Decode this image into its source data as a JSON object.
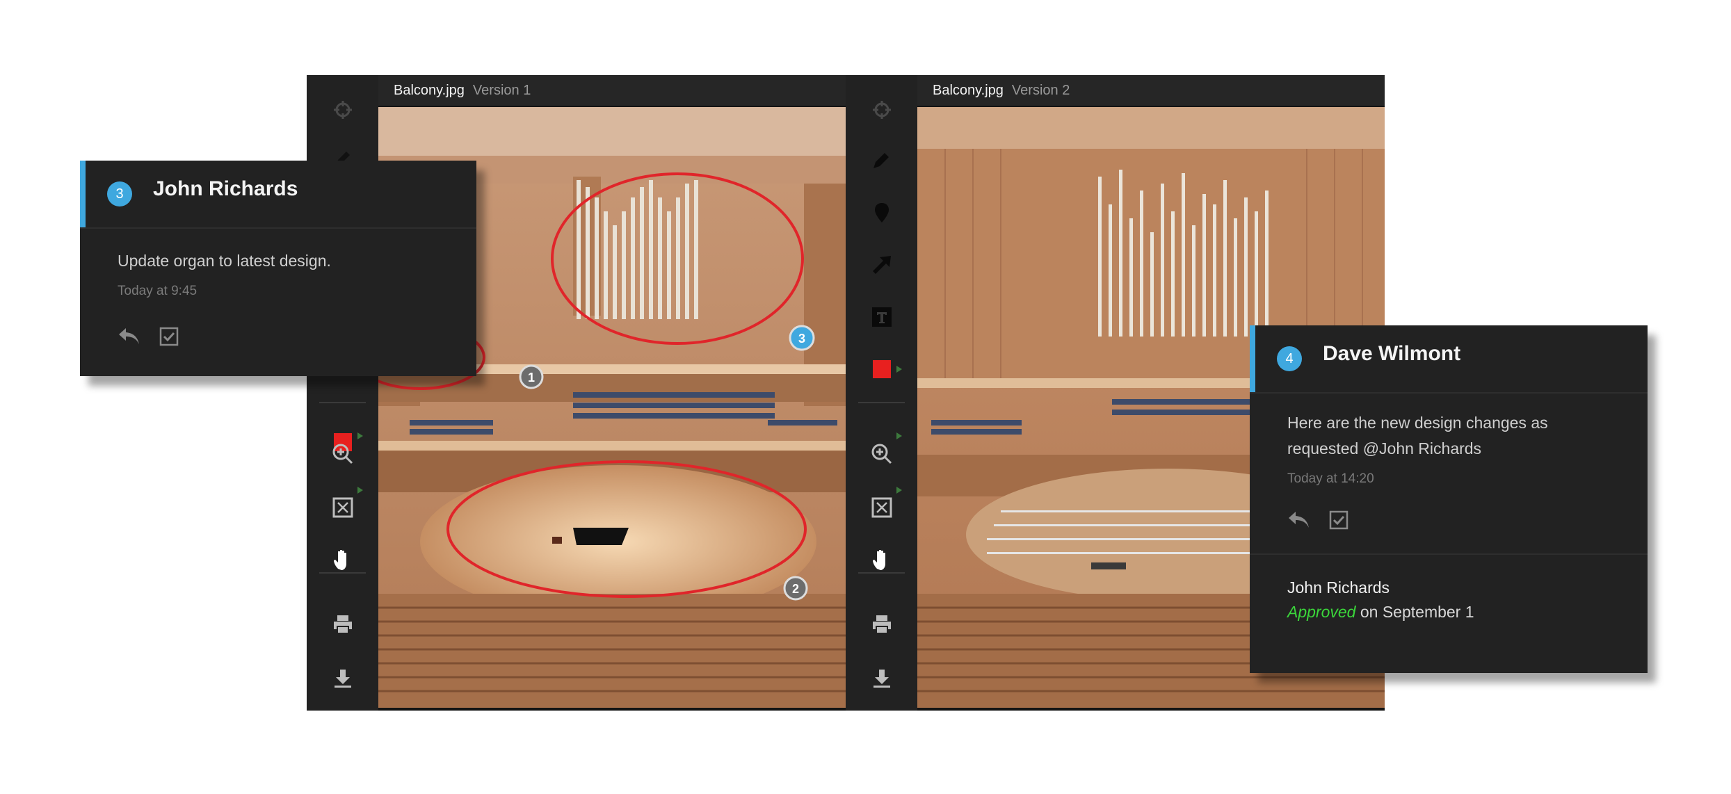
{
  "left_pane": {
    "filename": "Balcony.jpg",
    "version": "Version 1"
  },
  "right_pane": {
    "filename": "Balcony.jpg",
    "version": "Version 2"
  },
  "markers": [
    "1",
    "2",
    "3"
  ],
  "toolbar_tools": [
    "crosshair-icon",
    "pencil-icon",
    "pin-icon",
    "arrow-icon",
    "text-icon",
    "color-swatch",
    "zoom-icon",
    "fit-screen-icon",
    "hand-icon",
    "print-icon",
    "download-icon"
  ],
  "colors": {
    "accent": "#3fa8df",
    "annotation": "#e0252a",
    "approved": "#3bd63b",
    "swatch": "#e8201f"
  },
  "comment_left": {
    "number": "3",
    "author": "John Richards",
    "message": "Update organ to latest design.",
    "time": "Today at 9:45"
  },
  "comment_right": {
    "number": "4",
    "author": "Dave Wilmont",
    "message_line1": "Here are the new design changes as",
    "message_line2": "requested @John Richards",
    "time": "Today at 14:20",
    "approval_user": "John Richards",
    "approval_status": "Approved",
    "approval_date": "on September 1"
  }
}
